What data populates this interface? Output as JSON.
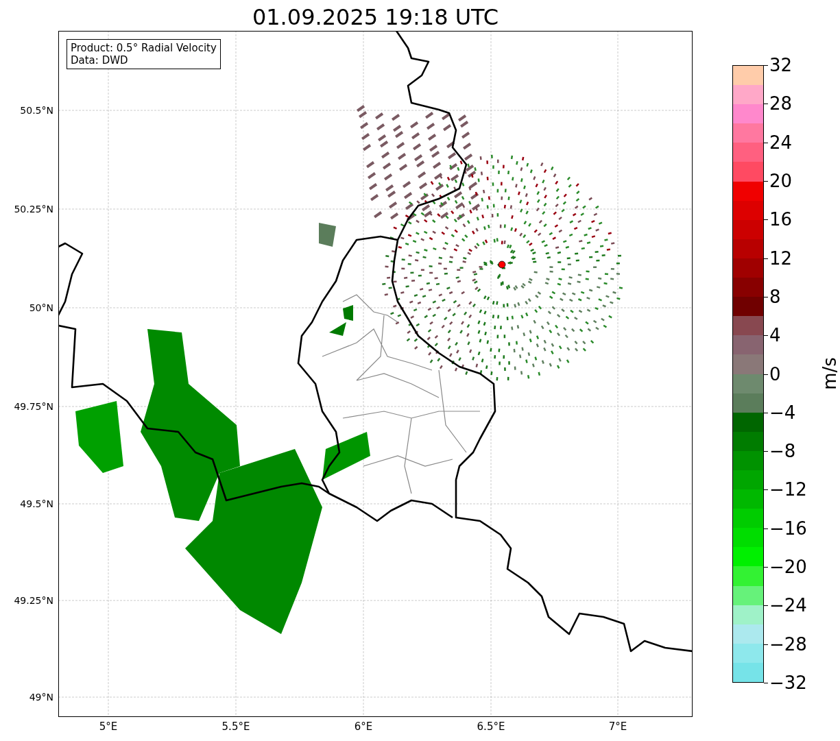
{
  "title": "01.09.2025 19:18 UTC",
  "info_box": {
    "lines": [
      "Product: 0.5° Radial Velocity",
      "Data: DWD"
    ]
  },
  "map": {
    "lat_labels": [
      "50.5°N",
      "50.25°N",
      "50°N",
      "49.75°N",
      "49.5°N",
      "49.25°N",
      "49°N"
    ],
    "lon_labels": [
      "5°E",
      "5.5°E",
      "6°E",
      "6.5°E",
      "7°E"
    ]
  },
  "colorbar": {
    "label": "m/s",
    "ticks": [
      "32",
      "28",
      "24",
      "20",
      "16",
      "12",
      "8",
      "4",
      "0",
      "−4",
      "−8",
      "−12",
      "−16",
      "−20",
      "−24",
      "−28",
      "−32"
    ],
    "segments": [
      {
        "color": "#76e3e8"
      },
      {
        "color": "#8ee8ec"
      },
      {
        "color": "#ace9ee"
      },
      {
        "color": "#9ff2c8"
      },
      {
        "color": "#66f27a"
      },
      {
        "color": "#33f233"
      },
      {
        "color": "#00f000"
      },
      {
        "color": "#00dd00"
      },
      {
        "color": "#00cc00"
      },
      {
        "color": "#00b800"
      },
      {
        "color": "#00a600"
      },
      {
        "color": "#009200"
      },
      {
        "color": "#007c00"
      },
      {
        "color": "#006600"
      },
      {
        "color": "#5b7d5b"
      },
      {
        "color": "#6e8a6e"
      },
      {
        "color": "#8a7878"
      },
      {
        "color": "#886470"
      },
      {
        "color": "#884850"
      },
      {
        "color": "#700000"
      },
      {
        "color": "#880000"
      },
      {
        "color": "#a00000"
      },
      {
        "color": "#b80000"
      },
      {
        "color": "#cc0000"
      },
      {
        "color": "#dd0000"
      },
      {
        "color": "#f00000"
      },
      {
        "color": "#ff4a62"
      },
      {
        "color": "#ff6080"
      },
      {
        "color": "#ff78a0"
      },
      {
        "color": "#ff88cc"
      },
      {
        "color": "#ffa8c8"
      },
      {
        "color": "#ffccaa"
      }
    ]
  }
}
